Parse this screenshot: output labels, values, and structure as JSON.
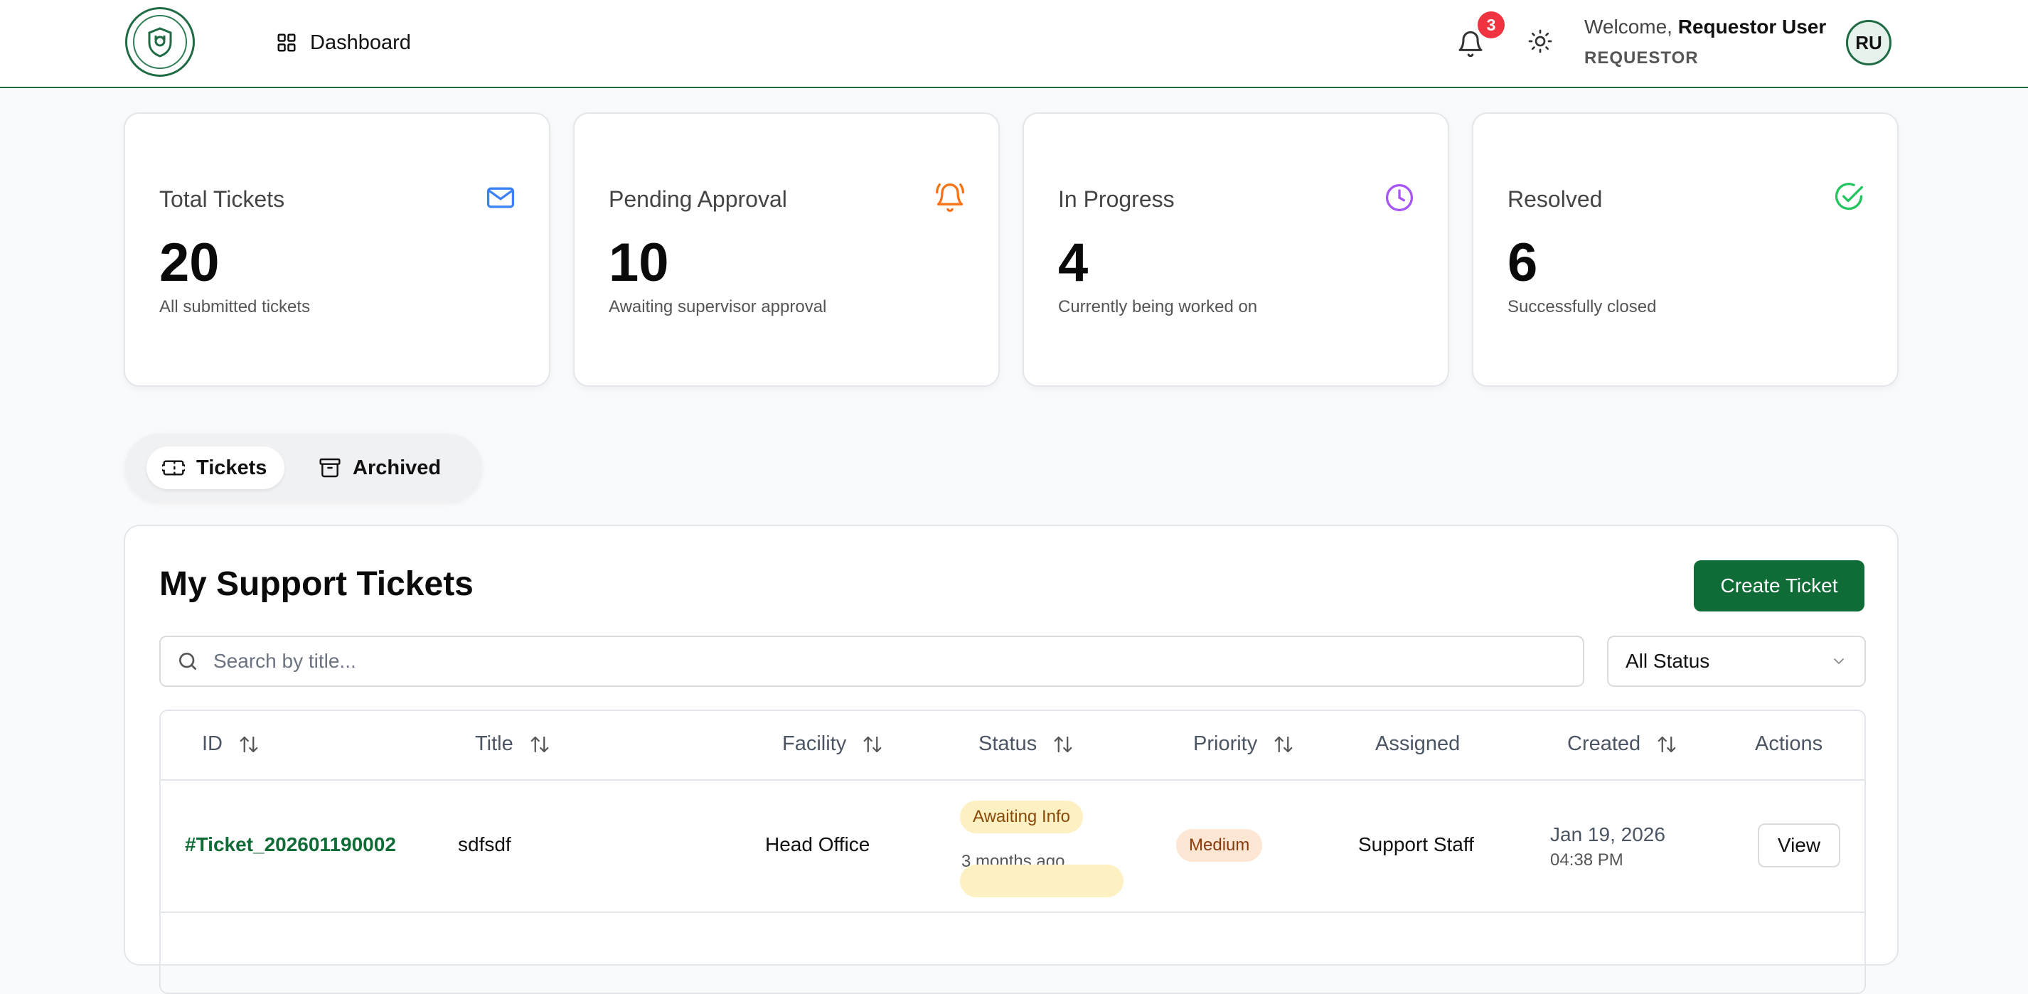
{
  "header": {
    "nav_dashboard": "Dashboard",
    "notifications_count": "3",
    "welcome_prefix": "Welcome,",
    "user_name": "Requestor User",
    "user_role": "REQUESTOR",
    "avatar_initials": "RU"
  },
  "stats": [
    {
      "title": "Total Tickets",
      "value": "20",
      "sub": "All submitted tickets",
      "icon": "mail-icon",
      "color": "#3b82f6"
    },
    {
      "title": "Pending Approval",
      "value": "10",
      "sub": "Awaiting supervisor approval",
      "icon": "bell-ring-icon",
      "color": "#f97316"
    },
    {
      "title": "In Progress",
      "value": "4",
      "sub": "Currently being worked on",
      "icon": "clock-icon",
      "color": "#a855f7"
    },
    {
      "title": "Resolved",
      "value": "6",
      "sub": "Successfully closed",
      "icon": "check-circle-icon",
      "color": "#22c55e"
    }
  ],
  "tabs": [
    {
      "label": "Tickets",
      "icon": "ticket-icon",
      "active": true
    },
    {
      "label": "Archived",
      "icon": "archive-icon",
      "active": false
    }
  ],
  "tickets_panel": {
    "title": "My Support Tickets",
    "create_label": "Create Ticket",
    "search_placeholder": "Search by title...",
    "status_filter": "All Status",
    "columns": [
      "ID",
      "Title",
      "Facility",
      "Status",
      "Priority",
      "Assigned",
      "Created",
      "Actions"
    ],
    "rows": [
      {
        "id": "#Ticket_202601190002",
        "title": "sdfsdf",
        "facility": "Head Office",
        "status": "Awaiting Info",
        "status_age": "3 months ago",
        "priority": "Medium",
        "assigned": "Support Staff",
        "created_date": "Jan 19, 2026",
        "created_time": "04:38 PM",
        "action": "View"
      }
    ]
  },
  "colors": {
    "brand_green": "#106c36",
    "badge_red": "#ef3340"
  }
}
